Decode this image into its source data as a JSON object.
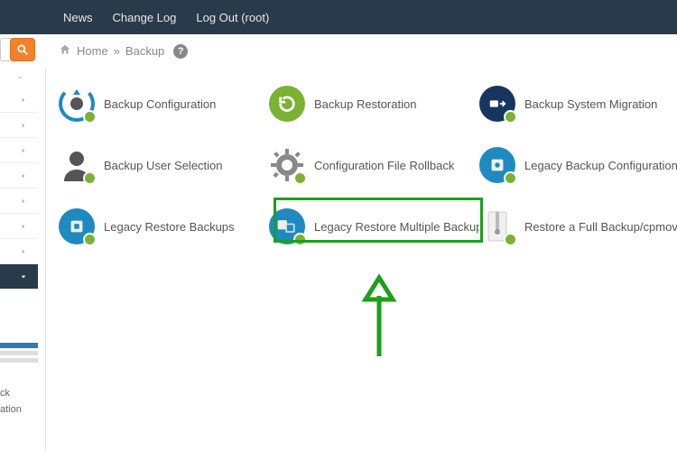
{
  "topbar": {
    "news": "News",
    "changelog": "Change Log",
    "logout": "Log Out (root)"
  },
  "search": {
    "placeholder": ""
  },
  "breadcrumb": {
    "home": "Home",
    "current": "Backup"
  },
  "sidebar_labels": {
    "line1": "ck",
    "line2": "ation"
  },
  "tiles": [
    {
      "label": "Backup Configuration"
    },
    {
      "label": "Backup Restoration"
    },
    {
      "label": "Backup System Migration"
    },
    {
      "label": "Backup User Selection"
    },
    {
      "label": "Configuration File Rollback"
    },
    {
      "label": "Legacy Backup Configuration"
    },
    {
      "label": "Legacy Restore Backups"
    },
    {
      "label": "Legacy Restore Multiple Backups"
    },
    {
      "label": "Restore a Full Backup/cpmove"
    }
  ]
}
